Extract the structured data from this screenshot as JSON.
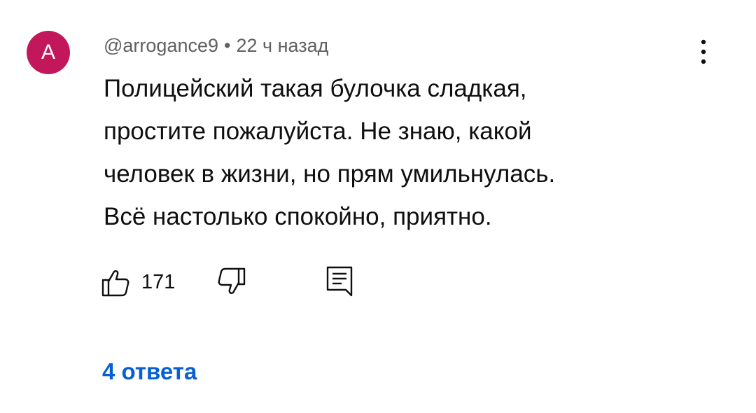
{
  "comment": {
    "avatar_letter": "A",
    "avatar_color": "#c2185b",
    "author": "@arrogance9",
    "separator": "•",
    "time_ago": "22 ч назад",
    "text_lines": [
      "Полицейский такая булочка сладкая,",
      "простите пожалуйста. Не знаю, какой",
      "человек в жизни, но прям умильнулась.",
      "Всё настолько спокойно, приятно."
    ],
    "like_count": "171",
    "replies_label": "4 ответа",
    "link_color": "#065fd4"
  },
  "icons": {
    "more": "more-vertical-icon",
    "like": "thumbs-up-icon",
    "dislike": "thumbs-down-icon",
    "reply": "comment-reply-icon"
  }
}
